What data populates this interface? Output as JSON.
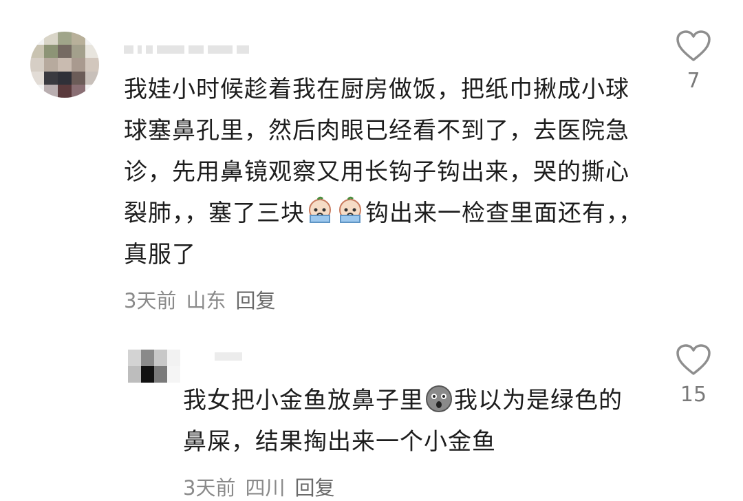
{
  "comment": {
    "text_parts": [
      "我娃小时候趁着我在厨房做饭，把纸巾揪成小球球塞鼻孔里，然后肉眼已经看不到了，去医院急诊，先用鼻镜观察又用长钩子钩出来，哭的撕心裂肺，，塞了三块",
      "钩出来一检查里面还有，，真服了"
    ],
    "emoji_icon": "crying-face-emoji",
    "time": "3天前",
    "location": "山东",
    "reply_label": "回复",
    "like_count": "7"
  },
  "reply": {
    "text_parts": [
      "我女把小金鱼放鼻子里",
      "我以为是绿色的鼻屎，结果掏出来一个小金鱼"
    ],
    "emoji_icon": "shocked-face-emoji",
    "time": "3天前",
    "location": "四川",
    "reply_label": "回复",
    "like_count": "15"
  },
  "icons": {
    "like": "heart-outline-icon"
  },
  "colors": {
    "text": "#1d1d1d",
    "meta": "#8a8a8a",
    "icon": "#8e8e8e"
  }
}
